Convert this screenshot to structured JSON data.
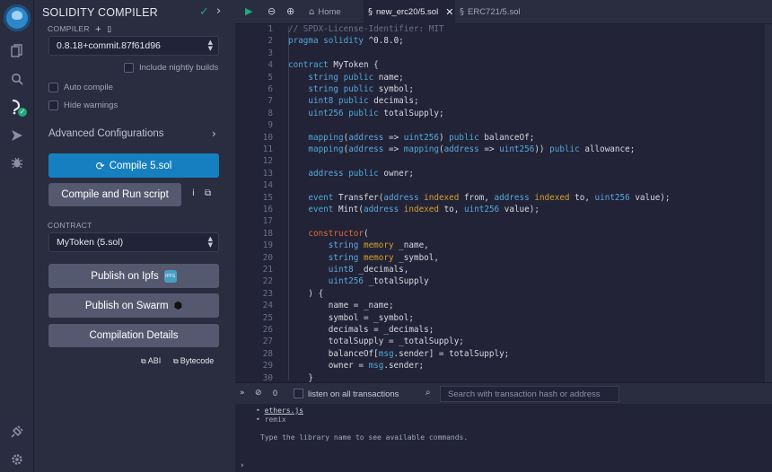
{
  "sidebar_rail": {
    "icons": [
      "remix-logo-icon",
      "files-icon",
      "search-icon",
      "solidity-compiler-icon",
      "deploy-run-icon",
      "debugger-icon",
      "plugin-icon",
      "settings-icon"
    ]
  },
  "compiler_panel": {
    "title": "SOLIDITY COMPILER",
    "compiler_label": "COMPILER",
    "compiler_version": "0.8.18+commit.87f61d96",
    "include_nightly_label": "Include nightly builds",
    "auto_compile_label": "Auto compile",
    "hide_warnings_label": "Hide warnings",
    "advanced_config_label": "Advanced Configurations",
    "compile_button": "Compile 5.sol",
    "compile_run_button": "Compile and Run script",
    "contract_label": "CONTRACT",
    "contract_selected": "MyToken (5.sol)",
    "publish_ipfs_button": "Publish on Ipfs",
    "ipfs_badge": "IPFS",
    "publish_swarm_button": "Publish on Swarm",
    "compilation_details_button": "Compilation Details",
    "abi_link": "ABI",
    "bytecode_link": "Bytecode"
  },
  "editor": {
    "tabs": [
      {
        "label": "Home"
      },
      {
        "label": "new_erc20/5.sol"
      },
      {
        "label": "ERC721/5.sol"
      }
    ],
    "line_numbers": [
      "1",
      "2",
      "3",
      "4",
      "5",
      "6",
      "7",
      "8",
      "9",
      "10",
      "11",
      "12",
      "13",
      "14",
      "15",
      "16",
      "17",
      "18",
      "19",
      "20",
      "21",
      "22",
      "23",
      "24",
      "25",
      "26",
      "27",
      "28",
      "29",
      "30"
    ]
  },
  "terminal": {
    "tx_count": "0",
    "listen_label": "listen on all transactions",
    "search_placeholder": "Search with transaction hash or address",
    "lines": [
      "ethers.js",
      "remix"
    ],
    "help_text": "Type the library name to see available commands."
  },
  "colors": {
    "accent_blue": "#167fbf",
    "success_green": "#1ea97c",
    "panel_bg": "#2a2c3f",
    "editor_bg": "#222336"
  }
}
